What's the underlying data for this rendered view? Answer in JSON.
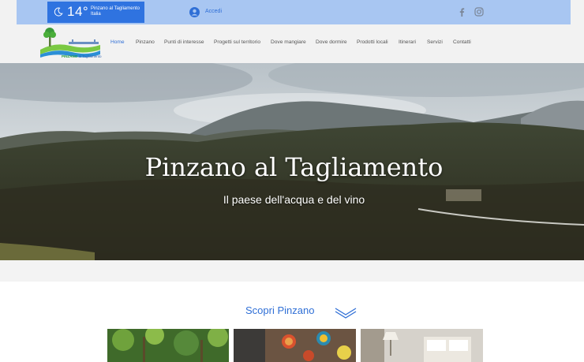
{
  "weather": {
    "temperature": "14°",
    "city": "Pinzano al Tagliamento",
    "country": "Italia"
  },
  "header": {
    "login_label": "Accedi"
  },
  "logo": {
    "name": "PINZANO",
    "suffix": "al Tagliamento"
  },
  "nav": [
    {
      "label": "Home",
      "active": true
    },
    {
      "label": "Pinzano",
      "active": false
    },
    {
      "label": "Punti di interesse",
      "active": false
    },
    {
      "label": "Progetti sul territorio",
      "active": false
    },
    {
      "label": "Dove mangiare",
      "active": false
    },
    {
      "label": "Dove dormire",
      "active": false
    },
    {
      "label": "Prodotti locali",
      "active": false
    },
    {
      "label": "Itinerari",
      "active": false
    },
    {
      "label": "Servizi",
      "active": false
    },
    {
      "label": "Contatti",
      "active": false
    }
  ],
  "hero": {
    "title": "Pinzano al Tagliamento",
    "subtitle": "Il paese dell'acqua e del vino"
  },
  "discover": {
    "title": "Scopri Pinzano"
  },
  "social_icons": [
    "facebook-icon",
    "instagram-icon"
  ],
  "colors": {
    "topbar": "#a8c6f2",
    "weather_bg": "#2f73e0",
    "accent": "#2f6fd6"
  }
}
